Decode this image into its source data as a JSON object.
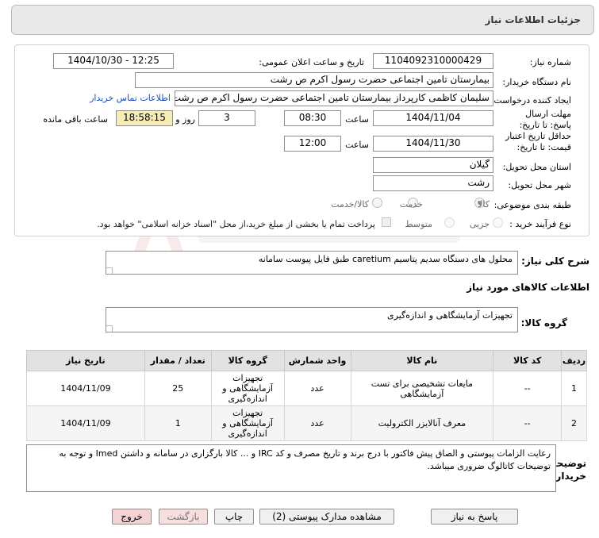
{
  "header": {
    "title": "جزئیات اطلاعات نیاز"
  },
  "form": {
    "need_number_label": "شماره نیاز:",
    "need_number": "1104092310000429",
    "announce_label": "تاریخ و ساعت اعلان عمومی:",
    "announce_value": "1404/10/30 - 12:25",
    "buyer_label": "نام دستگاه خریدار:",
    "buyer_value": "بیمارستان  تامین اجتماعی حضرت رسول اکرم ص رشت",
    "requester_label": "ایجاد کننده درخواست:",
    "requester_value": "سلیمان کاظمی کارپرداز بیمارستان  تامین اجتماعی حضرت رسول اکرم ص رشت",
    "contact_link": "اطلاعات تماس خریدار",
    "deadline_label": "مهلت ارسال پاسخ: تا تاریخ:",
    "deadline_date": "1404/11/04",
    "time_label": "ساعت",
    "deadline_time": "08:30",
    "days_value": "3",
    "days_label": "روز و",
    "remaining_time": "18:58:15",
    "remaining_label": "ساعت باقی مانده",
    "validity_label": "حداقل تاریخ اعتبار قیمت: تا تاریخ:",
    "validity_date": "1404/11/30",
    "validity_time_label": "ساعت",
    "validity_time": "12:00",
    "province_label": "استان محل تحویل:",
    "province_value": "گیلان",
    "city_label": "شهر محل تحویل:",
    "city_value": "رشت",
    "category_label": "طبقه بندی موضوعی:",
    "category_options": [
      "کالا",
      "خدمت",
      "کالا/خدمت"
    ],
    "category_selected": "کالا",
    "process_label": "نوع فرآیند خرید :",
    "process_options": [
      "جزیی",
      "متوسط"
    ],
    "process_note": "پرداخت تمام یا بخشی از مبلغ خرید،از محل \"اسناد خزانه اسلامی\" خواهد بود."
  },
  "summary": {
    "label": "شرح کلی نیاز:",
    "value": "محلول های دستگاه سدیم پتاسیم caretium طبق فایل پیوست سامانه"
  },
  "goods_info_title": "اطلاعات کالاهای مورد نیاز",
  "goods_group": {
    "label": "گروه کالا:",
    "value": "تجهیزات آزمایشگاهی و اندازه‌گیری"
  },
  "table": {
    "headers": [
      "ردیف",
      "کد کالا",
      "نام کالا",
      "واحد شمارش",
      "گروه کالا",
      "تعداد / مقدار",
      "تاریخ نیاز"
    ],
    "rows": [
      [
        "1",
        "--",
        "مایعات تشخیصی برای تست آزمایشگاهی",
        "عدد",
        "تجهیزات آزمایشگاهی و اندازه‌گیری",
        "25",
        "1404/11/09"
      ],
      [
        "2",
        "--",
        "معرف آنالایزر الکترولیت",
        "عدد",
        "تجهیزات آزمایشگاهی و اندازه‌گیری",
        "1",
        "1404/11/09"
      ]
    ]
  },
  "notes": {
    "label": "توضیحات خریدار:",
    "value": "رعایت الزامات پیوستی و الصاق پیش فاکتور با درج برند و تاریخ مصرف و کد IRC و ... کالا بارگزاری در سامانه و داشتن Imed و توجه به توضیحات کاتالوگ ضروری میباشد."
  },
  "buttons": {
    "reply": "پاسخ به نیاز",
    "attachments": "مشاهده مدارک پیوستی (2)",
    "print": "چاپ",
    "back": "بازگشت",
    "exit": "خروج"
  },
  "colors": {
    "link": "#1a4fb5",
    "remaining_bg": "#f6ecb8",
    "exit_bg": "#f6d3d3"
  }
}
